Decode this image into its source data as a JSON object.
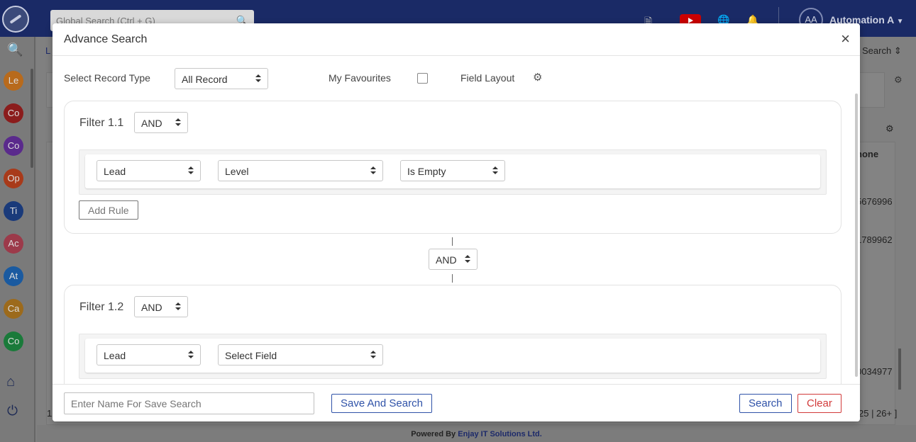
{
  "app": {
    "global_search_placeholder": "Global Search (Ctrl + G)",
    "user_initials": "AA",
    "user_name": "Automation A",
    "sidebar_items": [
      {
        "label": "Le",
        "color": "#b86a1c"
      },
      {
        "label": "Co",
        "color": "#8b1c1c"
      },
      {
        "label": "Co",
        "color": "#5a2a8c"
      },
      {
        "label": "Op",
        "color": "#a83a1a"
      },
      {
        "label": "Ti",
        "color": "#1a3a7a"
      },
      {
        "label": "Ac",
        "color": "#9c3a4a"
      },
      {
        "label": "At",
        "color": "#1a5aa0"
      },
      {
        "label": "Ca",
        "color": "#9c6a1c"
      },
      {
        "label": "Co",
        "color": "#1a7a3a"
      }
    ],
    "bg_breadcrumb": "L",
    "bg_search_label": "Search",
    "bg_column_header": "hone",
    "bg_cell_1": "5676996",
    "bg_cell_2": "1789962",
    "bg_cell_3": "0034977",
    "bg_page_num": "1",
    "bg_pagination": "25 | 26+ ]",
    "footer_prefix": "Powered By",
    "footer_brand": "Enjay IT Solutions Ltd."
  },
  "modal": {
    "title": "Advance Search",
    "close_glyph": "×",
    "record_type_label": "Select Record Type",
    "record_type_value": "All Record",
    "favourites_label": "My Favourites",
    "field_layout_label": "Field Layout",
    "filters": [
      {
        "title": "Filter 1.1",
        "operator": "AND",
        "rule": {
          "module": "Lead",
          "field": "Level",
          "condition": "Is Empty"
        },
        "add_rule_label": "Add Rule"
      },
      {
        "title": "Filter 1.2",
        "operator": "AND",
        "rule": {
          "module": "Lead",
          "field": "Select Field"
        }
      }
    ],
    "group_operator": "AND",
    "footer": {
      "save_name_placeholder": "Enter Name For Save Search",
      "save_and_search_label": "Save And Search",
      "search_label": "Search",
      "clear_label": "Clear"
    }
  },
  "colors": {
    "primary": "#2f52a8",
    "danger": "#d23a3a",
    "topbar": "#1a2a66"
  }
}
